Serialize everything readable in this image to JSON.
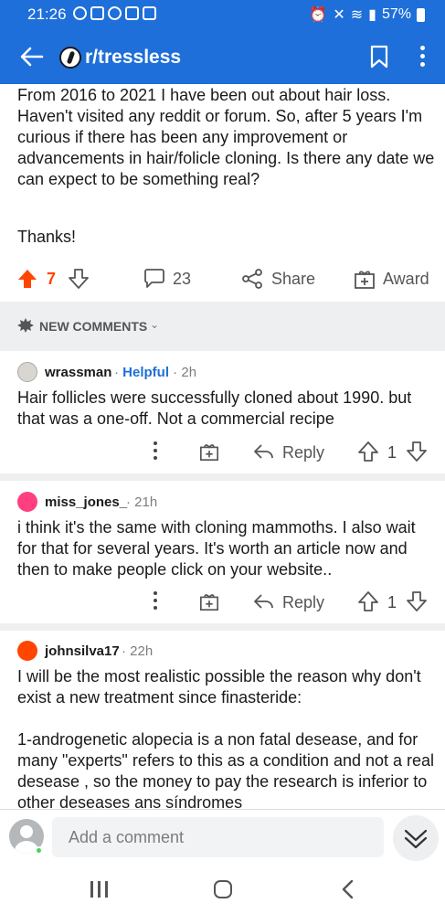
{
  "status_bar": {
    "time": "21:26",
    "battery": "57%"
  },
  "app_bar": {
    "subreddit": "r/tressless"
  },
  "post": {
    "body": "From 2016 to 2021 I have been out about hair loss. Haven't visited any reddit or forum. So, after 5 years I'm curious if there has been any improvement or advancements in hair/folicle cloning. Is there any date we can expect to be something real?",
    "thanks": "Thanks!",
    "votes": "7",
    "comments": "23",
    "share_label": "Share",
    "award_label": "Award"
  },
  "sort": {
    "label": "NEW COMMENTS"
  },
  "comments": [
    {
      "user": "wrassman",
      "flair": "Helpful",
      "age": "2h",
      "text": "Hair follicles were successfully cloned about 1990.  but that was a one-off.  Not a commercial recipe",
      "reply": "Reply",
      "score": "1"
    },
    {
      "user": "miss_jones_",
      "age": "21h",
      "text": "i think it's the same with cloning mammoths. I also wait for that for several years. It's worth an article now and then to make people click on your website..",
      "reply": "Reply",
      "score": "1"
    },
    {
      "user": "johnsilva17",
      "age": "22h",
      "text_p1": "I will be the most realistic possible the reason why don't exist a new treatment since finasteride:",
      "text_p2": "1-androgenetic alopecia is a non fatal desease, and for many \"experts\" refers to this as a condition and not a real desease , so the money to pay the research is inferior to other deseases ans síndromes"
    }
  ],
  "composer": {
    "placeholder": "Add a comment"
  },
  "colors": {
    "brand_blue": "#1e6fd9",
    "upvote_orange": "#ff4500",
    "flair_blue": "#1e6fd9",
    "online_green": "#46d160"
  }
}
